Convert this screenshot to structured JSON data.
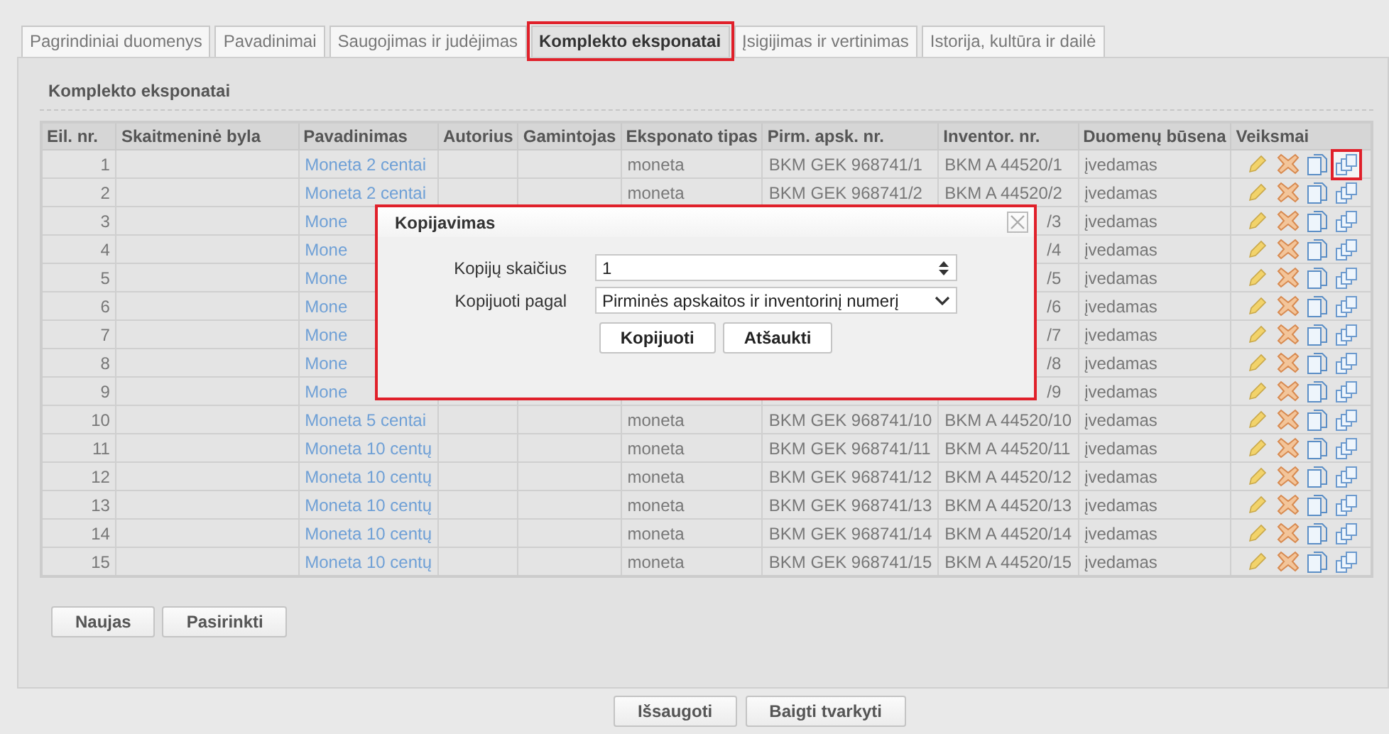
{
  "tabs": [
    {
      "label": "Pagrindiniai duomenys",
      "selected": false,
      "highlighted": false
    },
    {
      "label": "Pavadinimai",
      "selected": false,
      "highlighted": false
    },
    {
      "label": "Saugojimas ir judėjimas",
      "selected": false,
      "highlighted": false
    },
    {
      "label": "Komplekto eksponatai",
      "selected": true,
      "highlighted": true
    },
    {
      "label": "Įsigijimas ir vertinimas",
      "selected": false,
      "highlighted": false
    },
    {
      "label": "Istorija, kultūra ir dailė",
      "selected": false,
      "highlighted": false
    }
  ],
  "section_title": "Komplekto eksponatai",
  "table": {
    "columns": [
      "Eil. nr.",
      "Skaitmeninė byla",
      "Pavadinimas",
      "Autorius",
      "Gamintojas",
      "Eksponato tipas",
      "Pirm. apsk. nr.",
      "Inventor. nr.",
      "Duomenų būsena",
      "Veiksmai"
    ],
    "rows": [
      {
        "nr": "1",
        "name": "Moneta 2 centai",
        "type": "moneta",
        "pirm": "BKM GEK 968741/1",
        "inventor": "BKM A 44520/1",
        "status": "įvedamas",
        "covered": false,
        "copy_highlighted": true
      },
      {
        "nr": "2",
        "name": "Moneta 2 centai",
        "type": "moneta",
        "pirm": "BKM GEK 968741/2",
        "inventor": "BKM A 44520/2",
        "status": "įvedamas",
        "covered": false,
        "copy_highlighted": false
      },
      {
        "nr": "3",
        "name": "Mone",
        "inventor": "/3",
        "status": "įvedamas",
        "covered": true,
        "copy_highlighted": false
      },
      {
        "nr": "4",
        "name": "Mone",
        "inventor": "/4",
        "status": "įvedamas",
        "covered": true,
        "copy_highlighted": false
      },
      {
        "nr": "5",
        "name": "Mone",
        "inventor": "/5",
        "status": "įvedamas",
        "covered": true,
        "copy_highlighted": false
      },
      {
        "nr": "6",
        "name": "Mone",
        "inventor": "/6",
        "status": "įvedamas",
        "covered": true,
        "copy_highlighted": false
      },
      {
        "nr": "7",
        "name": "Mone",
        "inventor": "/7",
        "status": "įvedamas",
        "covered": true,
        "copy_highlighted": false
      },
      {
        "nr": "8",
        "name": "Mone",
        "inventor": "/8",
        "status": "įvedamas",
        "covered": true,
        "copy_highlighted": false
      },
      {
        "nr": "9",
        "name": "Mone",
        "inventor": "/9",
        "status": "įvedamas",
        "covered": true,
        "copy_highlighted": false
      },
      {
        "nr": "10",
        "name": "Moneta 5 centai",
        "type": "moneta",
        "pirm": "BKM GEK 968741/10",
        "inventor": "BKM A 44520/10",
        "status": "įvedamas",
        "covered": false,
        "copy_highlighted": false
      },
      {
        "nr": "11",
        "name": "Moneta 10 centų",
        "type": "moneta",
        "pirm": "BKM GEK 968741/11",
        "inventor": "BKM A 44520/11",
        "status": "įvedamas",
        "covered": false,
        "copy_highlighted": false
      },
      {
        "nr": "12",
        "name": "Moneta 10 centų",
        "type": "moneta",
        "pirm": "BKM GEK 968741/12",
        "inventor": "BKM A 44520/12",
        "status": "įvedamas",
        "covered": false,
        "copy_highlighted": false
      },
      {
        "nr": "13",
        "name": "Moneta 10 centų",
        "type": "moneta",
        "pirm": "BKM GEK 968741/13",
        "inventor": "BKM A 44520/13",
        "status": "įvedamas",
        "covered": false,
        "copy_highlighted": false
      },
      {
        "nr": "14",
        "name": "Moneta 10 centų",
        "type": "moneta",
        "pirm": "BKM GEK 968741/14",
        "inventor": "BKM A 44520/14",
        "status": "įvedamas",
        "covered": false,
        "copy_highlighted": false
      },
      {
        "nr": "15",
        "name": "Moneta 10 centų",
        "type": "moneta",
        "pirm": "BKM GEK 968741/15",
        "inventor": "BKM A 44520/15",
        "status": "įvedamas",
        "covered": false,
        "copy_highlighted": false
      }
    ]
  },
  "table_buttons": [
    "Naujas",
    "Pasirinkti"
  ],
  "dialog": {
    "title": "Kopijavimas",
    "highlighted": true,
    "fields": [
      {
        "kind": "number",
        "label": "Kopijų skaičius",
        "value": "1"
      },
      {
        "kind": "select",
        "label": "Kopijuoti pagal",
        "value": "Pirminės apskaitos ir inventorinį numerį"
      }
    ],
    "buttons": [
      "Kopijuoti",
      "Atšaukti"
    ]
  },
  "footer_buttons": [
    "Išsaugoti",
    "Baigti tvarkyti"
  ]
}
